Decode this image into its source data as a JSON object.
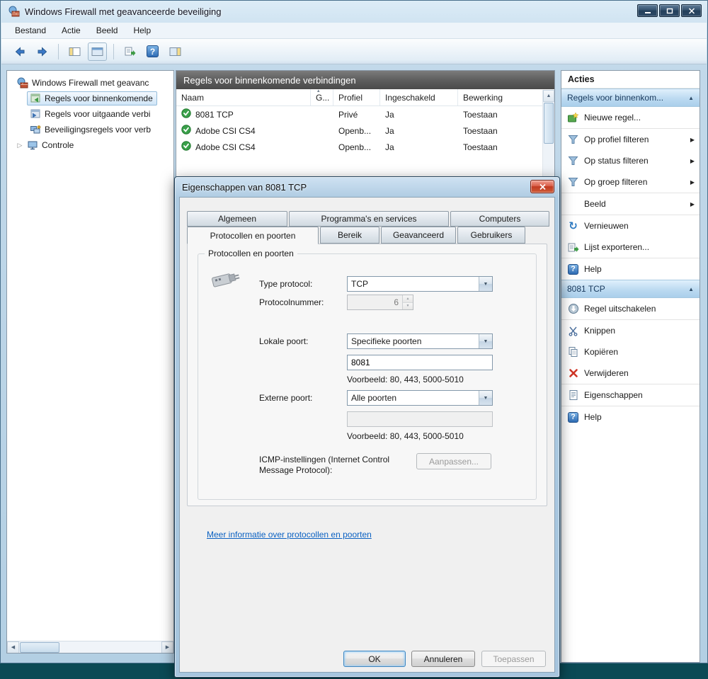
{
  "window": {
    "title": "Windows Firewall met geavanceerde beveiliging",
    "menu": [
      "Bestand",
      "Actie",
      "Beeld",
      "Help"
    ]
  },
  "tree": {
    "root": "Windows Firewall met geavanc",
    "items": [
      "Regels voor binnenkomende",
      "Regels voor uitgaande verbi",
      "Beveiligingsregels voor verb",
      "Controle"
    ]
  },
  "list": {
    "header": "Regels voor binnenkomende verbindingen",
    "columns": [
      "Naam",
      "G...",
      "Profiel",
      "Ingeschakeld",
      "Bewerking"
    ],
    "rows": [
      {
        "naam": "8081 TCP",
        "profiel": "Privé",
        "ingeschakeld": "Ja",
        "bewerking": "Toestaan"
      },
      {
        "naam": "Adobe CSI CS4",
        "profiel": "Openb...",
        "ingeschakeld": "Ja",
        "bewerking": "Toestaan"
      },
      {
        "naam": "Adobe CSI CS4",
        "profiel": "Openb...",
        "ingeschakeld": "Ja",
        "bewerking": "Toestaan"
      }
    ]
  },
  "actions": {
    "title": "Acties",
    "group1": {
      "header": "Regels voor binnenkom...",
      "items": [
        "Nieuwe regel...",
        "Op profiel filteren",
        "Op status filteren",
        "Op groep filteren",
        "Beeld",
        "Vernieuwen",
        "Lijst exporteren...",
        "Help"
      ]
    },
    "group2": {
      "header": "8081 TCP",
      "items": [
        "Regel uitschakelen",
        "Knippen",
        "Kopiëren",
        "Verwijderen",
        "Eigenschappen",
        "Help"
      ]
    }
  },
  "dialog": {
    "title": "Eigenschappen van 8081 TCP",
    "tabs_row1": [
      "Algemeen",
      "Programma's en services",
      "Computers"
    ],
    "tabs_row2": [
      "Protocollen en poorten",
      "Bereik",
      "Geavanceerd",
      "Gebruikers"
    ],
    "active_tab": "Protocollen en poorten",
    "group_label": "Protocollen en poorten",
    "fields": {
      "type_protocol_label": "Type protocol:",
      "type_protocol_value": "TCP",
      "protocolnummer_label": "Protocolnummer:",
      "protocolnummer_value": "6",
      "lokale_poort_label": "Lokale poort:",
      "lokale_poort_value": "Specifieke poorten",
      "lokale_poort_input": "8081",
      "lokale_voorbeeld": "Voorbeeld: 80, 443, 5000-5010",
      "externe_poort_label": "Externe poort:",
      "externe_poort_value": "Alle poorten",
      "externe_voorbeeld": "Voorbeeld: 80, 443, 5000-5010",
      "icmp_label": "ICMP-instellingen (Internet Control Message Protocol):",
      "icmp_button": "Aanpassen..."
    },
    "link": "Meer informatie over protocollen en poorten",
    "buttons": {
      "ok": "OK",
      "cancel": "Annuleren",
      "apply": "Toepassen"
    }
  },
  "icons": {
    "submenu": "▶",
    "collapse": "▲",
    "dropdown": "▼",
    "spin_up": "▲",
    "spin_down": "▼",
    "scroll_up": "▲",
    "scroll_left": "◀",
    "scroll_right": "▶",
    "sort": "▴",
    "help": "?",
    "expander": "▷",
    "refresh": "↻"
  },
  "colors": {
    "accent_blue": "#2f7cc4",
    "selection_blue": "#d0e5f7",
    "list_header_gray": "#5a5a5a",
    "close_red": "#c03a22",
    "link_blue": "#0b61c2",
    "check_green": "#3aa04a"
  }
}
